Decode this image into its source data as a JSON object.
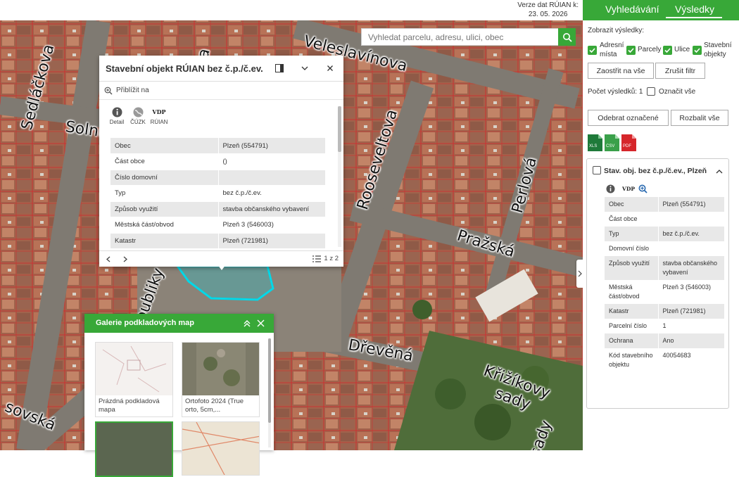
{
  "version": {
    "line1": "Verze dat RÚIAN k:",
    "line2": "23. 05. 2026"
  },
  "search": {
    "placeholder": "Vyhledat parcelu, adresu, ulici, obec",
    "icon": "search-icon"
  },
  "map": {
    "streets": [
      "Sedláčkova",
      "Solní",
      "Veleslavínova",
      "Rooseveltova",
      "Perlová",
      "Pražská",
      "Dřevěná",
      "Křižíkovy",
      "sady",
      "Republiky",
      "sovská",
      "sady",
      "ka"
    ]
  },
  "popup": {
    "title": "Stavební objekt RÚIAN bez č.p./č.ev.",
    "zoom_label": "Přiblížit na",
    "tools": [
      {
        "label": "Detail",
        "icon": "info-icon"
      },
      {
        "label": "ČÚZK",
        "icon": "cuzk-globe-icon"
      },
      {
        "label": "RÚIAN",
        "icon": "vdp-icon",
        "glyph": "VDP"
      }
    ],
    "rows": [
      {
        "key": "Obec",
        "value": "Plzeň (554791)"
      },
      {
        "key": "Část obce",
        "value": "()"
      },
      {
        "key": "Číslo domovní",
        "value": ""
      },
      {
        "key": "Typ",
        "value": "bez č.p./č.ev."
      },
      {
        "key": "Způsob využití",
        "value": "stavba občanského vybavení"
      },
      {
        "key": "Městská část/obvod",
        "value": "Plzeň 3 (546003)"
      },
      {
        "key": "Katastr",
        "value": "Plzeň (721981)"
      }
    ],
    "pager": "1 z 2"
  },
  "gallery": {
    "title": "Galerie podkladových map",
    "items": [
      {
        "caption": "Prázdná podkladová mapa"
      },
      {
        "caption": "Ortofoto 2024 (True orto, 5cm,..."
      },
      {
        "caption": ""
      },
      {
        "caption": ""
      }
    ]
  },
  "panel": {
    "tabs": [
      "Vyhledávání",
      "Výsledky"
    ],
    "show_label": "Zobrazit výsledky:",
    "filters": [
      {
        "label": "Adresní místa",
        "checked": true
      },
      {
        "label": "Parcely",
        "checked": true
      },
      {
        "label": "Ulice",
        "checked": true
      },
      {
        "label": "Stavební objekty",
        "checked": true
      }
    ],
    "focus_all": "Zaostřit na vše",
    "cancel_filter": "Zrušit filtr",
    "count_label": "Počet výsledků: 1",
    "mark_all": "Označit vše",
    "remove_marked": "Odebrat označené",
    "expand_all": "Rozbalit vše",
    "exports": [
      {
        "label": "XLS",
        "color": "#1f7a3a"
      },
      {
        "label": "CSV",
        "color": "#3aa04a"
      },
      {
        "label": "PDF",
        "color": "#d6262b"
      }
    ],
    "card": {
      "title": "Stav. obj. bez č.p./č.ev., Plzeň",
      "vdp": "VDP",
      "rows": [
        {
          "key": "Obec",
          "value": "Plzeň (554791)"
        },
        {
          "key": "Část obce",
          "value": ""
        },
        {
          "key": "Typ",
          "value": "bez č.p./č.ev."
        },
        {
          "key": "Domovní číslo",
          "value": ""
        },
        {
          "key": "Způsob využití",
          "value": "stavba občanského vybavení"
        },
        {
          "key": "Městská část/obvod",
          "value": "Plzeň 3 (546003)"
        },
        {
          "key": "Katastr",
          "value": "Plzeň (721981)"
        },
        {
          "key": "Parcelní číslo",
          "value": "1"
        },
        {
          "key": "Ochrana",
          "value": "Ano"
        },
        {
          "key": "Kód stavebního objektu",
          "value": "40054683"
        }
      ]
    }
  },
  "colors": {
    "accent": "#38a838",
    "parcel": "#d8262b",
    "highlight": "#00d8e8"
  }
}
